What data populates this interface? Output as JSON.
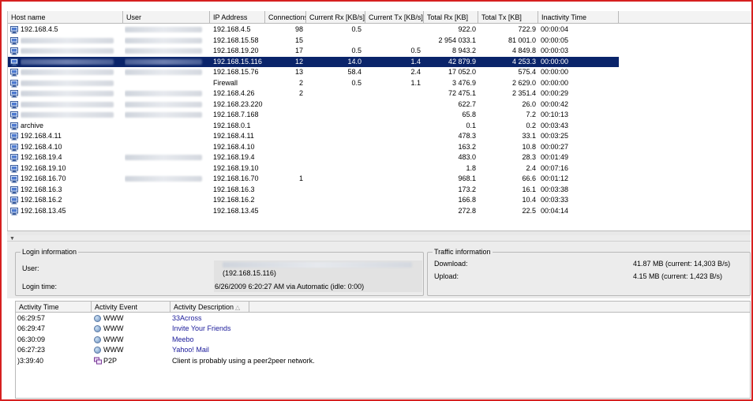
{
  "hosts": {
    "columns": [
      "Host name",
      "User",
      "IP Address",
      "Connections",
      "Current Rx [KB/s]",
      "Current Tx [KB/s]",
      "Total Rx [KB]",
      "Total Tx [KB]",
      "Inactivity Time"
    ],
    "rows": [
      {
        "host": "192.168.4.5",
        "host_hidden": false,
        "user_hidden": true,
        "ip": "192.168.4.5",
        "conn": "98",
        "rx": "0.5",
        "tx": "",
        "trx": "922.0",
        "ttx": "722.9",
        "inact": "00:00:04",
        "selected": false
      },
      {
        "host": "",
        "host_hidden": true,
        "user_hidden": true,
        "ip": "192.168.15.58",
        "conn": "15",
        "rx": "",
        "tx": "",
        "trx": "2 954 033.1",
        "ttx": "81 001.0",
        "inact": "00:00:05",
        "selected": false
      },
      {
        "host": "",
        "host_hidden": true,
        "user_hidden": true,
        "ip": "192.168.19.20",
        "conn": "17",
        "rx": "0.5",
        "tx": "0.5",
        "trx": "8 943.2",
        "ttx": "4 849.8",
        "inact": "00:00:03",
        "selected": false
      },
      {
        "host": "",
        "host_hidden": true,
        "user_hidden": true,
        "ip": "192.168.15.116",
        "conn": "12",
        "rx": "14.0",
        "tx": "1.4",
        "trx": "42 879.9",
        "ttx": "4 253.3",
        "inact": "00:00:00",
        "selected": true
      },
      {
        "host": "",
        "host_hidden": true,
        "user_hidden": true,
        "ip": "192.168.15.76",
        "conn": "13",
        "rx": "58.4",
        "tx": "2.4",
        "trx": "17 052.0",
        "ttx": "575.4",
        "inact": "00:00:00",
        "selected": false
      },
      {
        "host": "",
        "host_hidden": true,
        "user_hidden": false,
        "ip": "Firewall",
        "conn": "2",
        "rx": "0.5",
        "tx": "1.1",
        "trx": "3 476.9",
        "ttx": "2 629.0",
        "inact": "00:00:00",
        "selected": false
      },
      {
        "host": "",
        "host_hidden": true,
        "user_hidden": true,
        "ip": "192.168.4.26",
        "conn": "2",
        "rx": "",
        "tx": "",
        "trx": "72 475.1",
        "ttx": "2 351.4",
        "inact": "00:00:29",
        "selected": false
      },
      {
        "host": "",
        "host_hidden": true,
        "user_hidden": true,
        "ip": "192.168.23.220",
        "conn": "",
        "rx": "",
        "tx": "",
        "trx": "622.7",
        "ttx": "26.0",
        "inact": "00:00:42",
        "selected": false
      },
      {
        "host": "",
        "host_hidden": true,
        "user_hidden": true,
        "ip": "192.168.7.168",
        "conn": "",
        "rx": "",
        "tx": "",
        "trx": "65.8",
        "ttx": "7.2",
        "inact": "00:10:13",
        "selected": false
      },
      {
        "host": "archive",
        "host_hidden": false,
        "user_hidden": false,
        "ip": "192.168.0.1",
        "conn": "",
        "rx": "",
        "tx": "",
        "trx": "0.1",
        "ttx": "0.2",
        "inact": "00:03:43",
        "selected": false
      },
      {
        "host": "192.168.4.11",
        "host_hidden": false,
        "user_hidden": false,
        "ip": "192.168.4.11",
        "conn": "",
        "rx": "",
        "tx": "",
        "trx": "478.3",
        "ttx": "33.1",
        "inact": "00:03:25",
        "selected": false
      },
      {
        "host": "192.168.4.10",
        "host_hidden": false,
        "user_hidden": false,
        "ip": "192.168.4.10",
        "conn": "",
        "rx": "",
        "tx": "",
        "trx": "163.2",
        "ttx": "10.8",
        "inact": "00:00:27",
        "selected": false
      },
      {
        "host": "192.168.19.4",
        "host_hidden": false,
        "user_hidden": true,
        "ip": "192.168.19.4",
        "conn": "",
        "rx": "",
        "tx": "",
        "trx": "483.0",
        "ttx": "28.3",
        "inact": "00:01:49",
        "selected": false
      },
      {
        "host": "192.168.19.10",
        "host_hidden": false,
        "user_hidden": false,
        "ip": "192.168.19.10",
        "conn": "",
        "rx": "",
        "tx": "",
        "trx": "1.8",
        "ttx": "2.4",
        "inact": "00:07:16",
        "selected": false
      },
      {
        "host": "192.168.16.70",
        "host_hidden": false,
        "user_hidden": true,
        "ip": "192.168.16.70",
        "conn": "1",
        "rx": "",
        "tx": "",
        "trx": "968.1",
        "ttx": "66.6",
        "inact": "00:01:12",
        "selected": false
      },
      {
        "host": "192.168.16.3",
        "host_hidden": false,
        "user_hidden": false,
        "ip": "192.168.16.3",
        "conn": "",
        "rx": "",
        "tx": "",
        "trx": "173.2",
        "ttx": "16.1",
        "inact": "00:03:38",
        "selected": false
      },
      {
        "host": "192.168.16.2",
        "host_hidden": false,
        "user_hidden": false,
        "ip": "192.168.16.2",
        "conn": "",
        "rx": "",
        "tx": "",
        "trx": "166.8",
        "ttx": "10.4",
        "inact": "00:03:33",
        "selected": false
      },
      {
        "host": "192.168.13.45",
        "host_hidden": false,
        "user_hidden": false,
        "ip": "192.168.13.45",
        "conn": "",
        "rx": "",
        "tx": "",
        "trx": "272.8",
        "ttx": "22.5",
        "inact": "00:04:14",
        "selected": false
      }
    ]
  },
  "login": {
    "legend": "Login information",
    "user_label": "User:",
    "user_ip": "(192.168.15.116)",
    "time_label": "Login time:",
    "time_value": "6/26/2009 6:20:27 AM via Automatic (idle: 0:00)"
  },
  "traffic": {
    "legend": "Traffic information",
    "download_label": "Download:",
    "download_value": "41.87 MB (current: 14,303 B/s)",
    "upload_label": "Upload:",
    "upload_value": "4.15 MB (current: 1,423 B/s)"
  },
  "activity": {
    "columns": [
      "Activity Time",
      "Activity Event",
      "Activity Description"
    ],
    "rows": [
      {
        "time": "06:29:57",
        "event": "WWW",
        "icon": "globe-icon",
        "desc": "33Across",
        "link": true
      },
      {
        "time": "06:29:47",
        "event": "WWW",
        "icon": "globe-icon",
        "desc": "Invite Your Friends",
        "link": true
      },
      {
        "time": "06:30:09",
        "event": "WWW",
        "icon": "globe-icon",
        "desc": "Meebo",
        "link": true
      },
      {
        "time": "06:27:23",
        "event": "WWW",
        "icon": "globe-icon",
        "desc": "Yahoo! Mail",
        "link": true
      },
      {
        "time": ")3:39:40",
        "event": "P2P",
        "icon": "p2p-icon",
        "desc": "Client is probably using a peer2peer network.",
        "link": false
      }
    ]
  },
  "colors": {
    "selection": "#0a246a",
    "frame": "#d62020",
    "link": "#1a1a9a"
  }
}
